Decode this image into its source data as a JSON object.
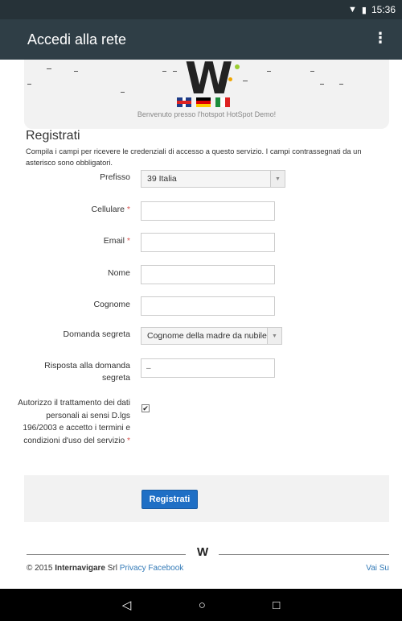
{
  "status_bar": {
    "time": "15:36"
  },
  "app_bar": {
    "title": "Accedi alla rete",
    "menu_icon": "⋮"
  },
  "hero": {
    "welcome": "Benvenuto presso l'hotspot HotSpot Demo!",
    "languages": [
      "English",
      "Deutsch",
      "Italiano"
    ]
  },
  "form": {
    "title": "Registrati",
    "description": "Compila i campi per ricevere le credenziali di accesso a questo servizio. I campi contrassegnati da un asterisco sono obbligatori.",
    "prefix_label": "Prefisso",
    "prefix_value": "39 Italia",
    "mobile_label": "Cellulare",
    "email_label": "Email",
    "name_label": "Nome",
    "surname_label": "Cognome",
    "secret_question_label": "Domanda segreta",
    "secret_question_value": "Cognome della madre da nubile",
    "secret_answer_label_1": "Risposta alla domanda",
    "secret_answer_label_2": "segreta",
    "secret_answer_placeholder": "–",
    "consent_text": "Autorizzo il trattamento dei dati personali ai sensi D.lgs 196/2003 e accetto i termini e condizioni d'uso del servizio",
    "required_mark": "*",
    "submit_label": "Registrati"
  },
  "footer": {
    "copyright_prefix": "© 2015",
    "company": "Internavigare",
    "company_suffix": "Srl",
    "privacy": "Privacy",
    "facebook": "Facebook",
    "back_to_top": "Vai Su"
  },
  "nav": {
    "back": "◁",
    "home": "○",
    "recents": "□"
  },
  "colors": {
    "app_bar": "#2f3e46",
    "accent": "#1f6fc5",
    "required": "#d9534f",
    "link": "#337ab7"
  }
}
